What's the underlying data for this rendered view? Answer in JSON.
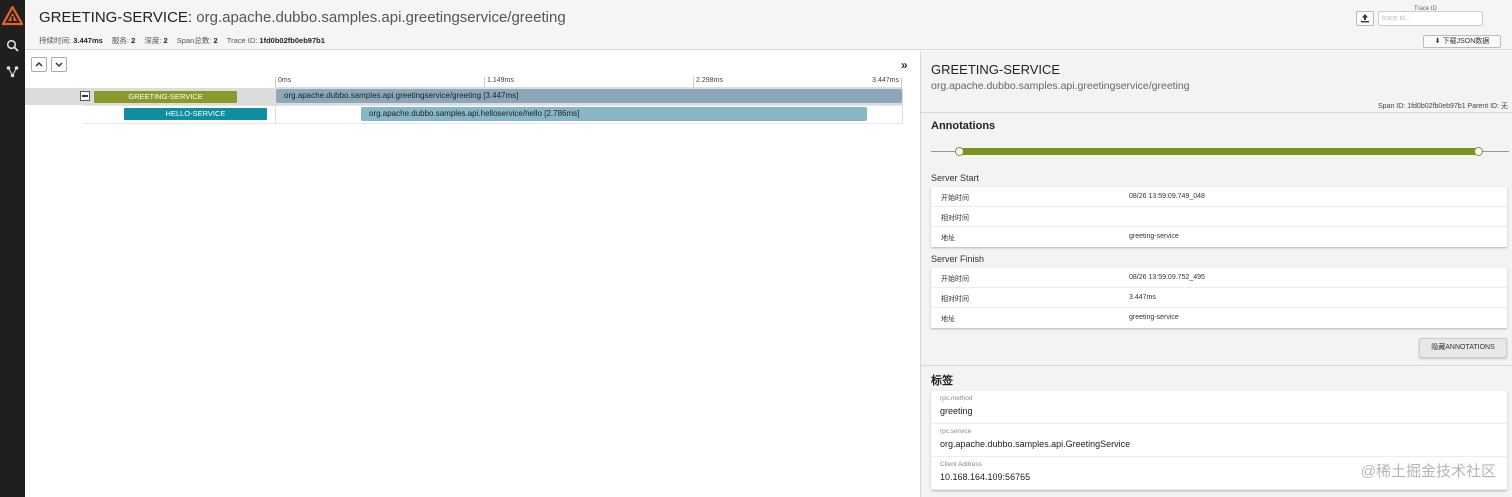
{
  "header": {
    "service": "GREETING-SERVICE",
    "separator": ":",
    "operation": "org.apache.dubbo.samples.api.greetingservice/greeting",
    "meta": [
      {
        "label": "持续时间:",
        "value": "3.447ms"
      },
      {
        "label": "服务:",
        "value": "2"
      },
      {
        "label": "深度:",
        "value": "2"
      },
      {
        "label": "Span总数:",
        "value": "2"
      },
      {
        "label": "Trace ID:",
        "value": "1fd0b02fb0eb97b1"
      }
    ],
    "trace_id_label": "Trace ID",
    "trace_id_placeholder": "trace id...",
    "download_label": "下载JSON数据"
  },
  "timeline": {
    "ticks": [
      "0ms",
      "1.149ms",
      "2.298ms",
      "3.447ms"
    ],
    "spans": [
      {
        "service": "GREETING-SERVICE",
        "label": "org.apache.dubbo.samples.api.greetingservice/greeting [3.447ms]",
        "color": "#8a9a2a",
        "bar_color": "#8aa8b8"
      },
      {
        "service": "HELLO-SERVICE",
        "label": "org.apache.dubbo.samples.api.helloservice/hello [2.786ms]",
        "color": "#0e8ea0",
        "bar_color": "#87b6c8"
      }
    ]
  },
  "detail": {
    "title": "GREETING-SERVICE",
    "subtitle": "org.apache.dubbo.samples.api.greetingservice/greeting",
    "ids": "Span ID: 1fd0b02fb0eb97b1   Parent ID: 无",
    "annotations_title": "Annotations",
    "annotation_color": "#7b9420",
    "groups": [
      {
        "title": "Server Start",
        "rows": [
          {
            "k": "开始时间",
            "v": "08/26 13:59:09.749_048"
          },
          {
            "k": "相对时间",
            "v": ""
          },
          {
            "k": "地址",
            "v": "greeting-service"
          }
        ]
      },
      {
        "title": "Server Finish",
        "rows": [
          {
            "k": "开始时间",
            "v": "08/26 13:59:09.752_495"
          },
          {
            "k": "相对时间",
            "v": "3.447ms"
          },
          {
            "k": "地址",
            "v": "greeting-service"
          }
        ]
      }
    ],
    "hide_label": "隐藏ANNOTATIONS",
    "tags_title": "标签",
    "tags": [
      {
        "k": "rpc.method",
        "v": "greeting"
      },
      {
        "k": "rpc.service",
        "v": "org.apache.dubbo.samples.api.GreetingService"
      },
      {
        "k": "Client Address",
        "v": "10.168.164.109:56765"
      }
    ]
  },
  "watermark": "@稀土掘金技术社区"
}
